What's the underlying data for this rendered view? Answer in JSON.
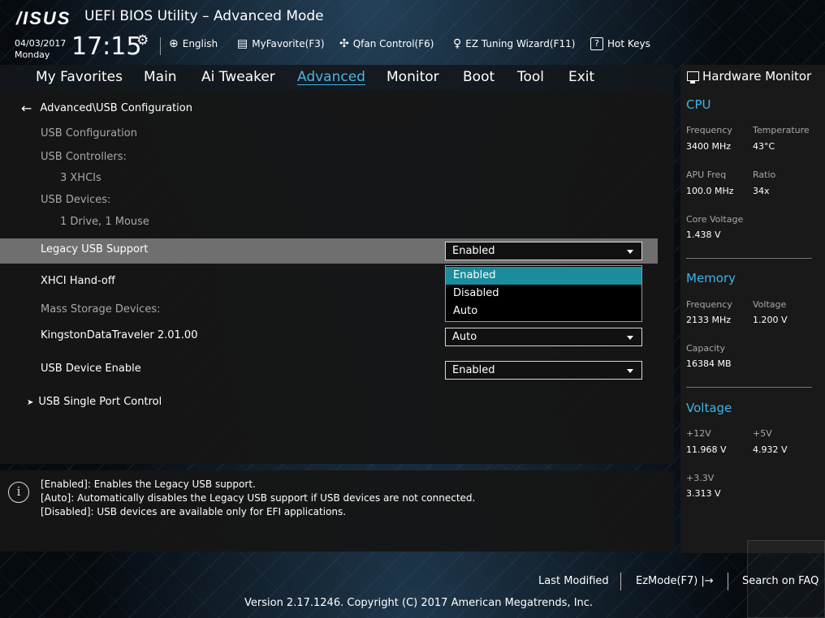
{
  "header": {
    "logo": "/ISUS",
    "title": "UEFI BIOS Utility – Advanced Mode",
    "date": "04/03/2017",
    "day": "Monday",
    "time": "17:15",
    "tools": {
      "language": "English",
      "myfavorite": "MyFavorite(F3)",
      "qfan": "Qfan Control(F6)",
      "ez_tuning": "EZ Tuning Wizard(F11)",
      "hotkeys": "Hot Keys"
    }
  },
  "nav": {
    "items": [
      "My Favorites",
      "Main",
      "Ai Tweaker",
      "Advanced",
      "Monitor",
      "Boot",
      "Tool",
      "Exit"
    ],
    "active": "Advanced"
  },
  "main": {
    "breadcrumb": "Advanced\\USB Configuration",
    "usb_configuration": "USB Configuration",
    "usb_controllers_label": "USB Controllers:",
    "usb_controllers_value": "3 XHCIs",
    "usb_devices_label": "USB Devices:",
    "usb_devices_value": "1 Drive, 1 Mouse",
    "legacy_usb_label": "Legacy USB Support",
    "legacy_usb_value": "Enabled",
    "legacy_usb_options": [
      "Enabled",
      "Disabled",
      "Auto"
    ],
    "xhci_label": "XHCI Hand-off",
    "mass_storage_label": "Mass Storage Devices:",
    "kingston_label": "KingstonDataTraveler 2.01.00",
    "kingston_value": "Auto",
    "usb_device_enable_label": "USB Device Enable",
    "usb_device_enable_value": "Enabled",
    "single_port_label": "USB Single Port Control"
  },
  "help": {
    "lines": [
      "[Enabled]: Enables the Legacy USB support.",
      "[Auto]: Automatically disables the Legacy USB support if USB devices are not connected.",
      "[Disabled]: USB devices are available only for EFI applications."
    ]
  },
  "hardware_monitor": {
    "title": "Hardware Monitor",
    "cpu": {
      "heading": "CPU",
      "frequency_label": "Frequency",
      "frequency": "3400 MHz",
      "temperature_label": "Temperature",
      "temperature": "43°C",
      "apu_freq_label": "APU Freq",
      "apu_freq": "100.0 MHz",
      "ratio_label": "Ratio",
      "ratio": "34x",
      "core_voltage_label": "Core Voltage",
      "core_voltage": "1.438 V"
    },
    "memory": {
      "heading": "Memory",
      "frequency_label": "Frequency",
      "frequency": "2133 MHz",
      "voltage_label": "Voltage",
      "voltage": "1.200 V",
      "capacity_label": "Capacity",
      "capacity": "16384 MB"
    },
    "voltage": {
      "heading": "Voltage",
      "v12_label": "+12V",
      "v12": "11.968 V",
      "v5_label": "+5V",
      "v5": "4.932 V",
      "v33_label": "+3.3V",
      "v33": "3.313 V"
    }
  },
  "footer": {
    "last_modified": "Last Modified",
    "ezmode": "EzMode(F7)",
    "search_faq": "Search on FAQ",
    "copyright": "Version 2.17.1246. Copyright (C) 2017 American Megatrends, Inc."
  },
  "colors": {
    "accent": "#3db4e6",
    "active_tab": "#4fb3e0",
    "selected_option": "#1a8c9c",
    "highlight_row": "#6f6f6f"
  }
}
